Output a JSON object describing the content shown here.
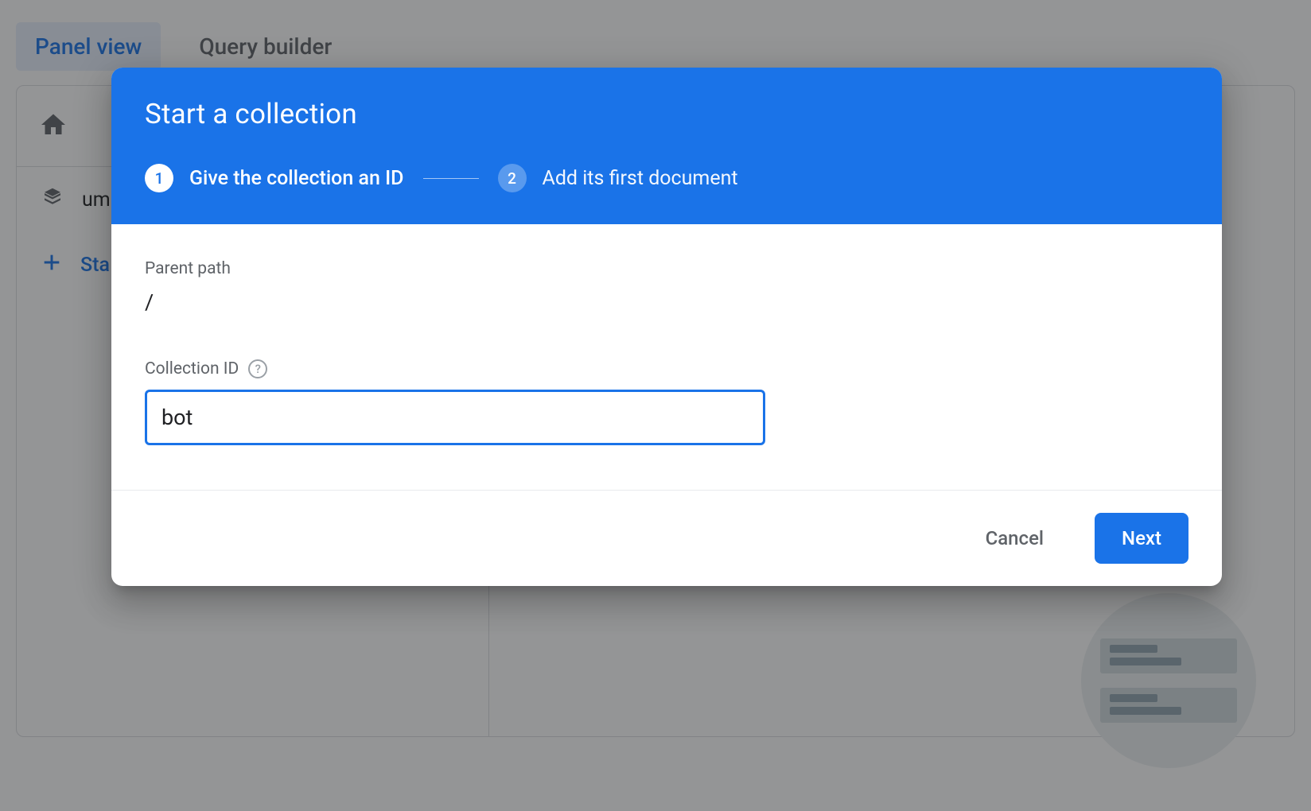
{
  "tabs": {
    "panel_view": "Panel view",
    "query_builder": "Query builder"
  },
  "sidebar": {
    "stream_label": "um",
    "start_collection": "Sta"
  },
  "dialog": {
    "title": "Start a collection",
    "steps": {
      "step1_num": "1",
      "step1_label": "Give the collection an ID",
      "step2_num": "2",
      "step2_label": "Add its first document"
    },
    "parent_path_label": "Parent path",
    "parent_path_value": "/",
    "collection_id_label": "Collection ID",
    "collection_id_value": "bot",
    "cancel_label": "Cancel",
    "next_label": "Next"
  }
}
